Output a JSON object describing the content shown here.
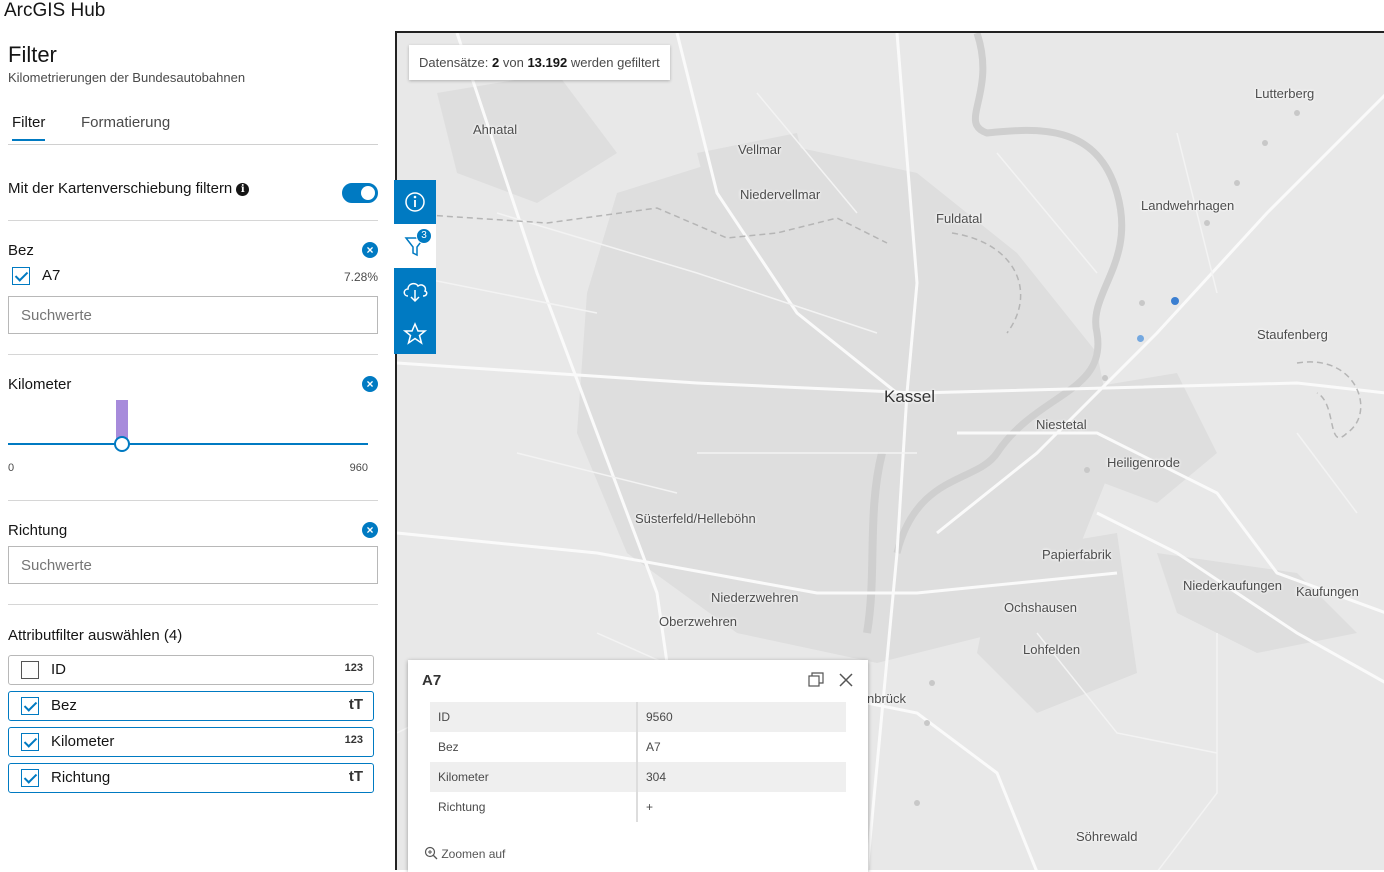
{
  "app": {
    "title": "ArcGIS Hub"
  },
  "panel": {
    "title": "Filter",
    "subtitle": "Kilometrierungen der Bundesautobahnen",
    "tabs": [
      {
        "label": "Filter"
      },
      {
        "label": "Formatierung"
      }
    ],
    "map_filter_toggle": {
      "label": "Mit der Kartenverschiebung filtern",
      "on": true
    }
  },
  "filters": {
    "bez": {
      "label": "Bez",
      "value_label": "A7",
      "checked": true,
      "percent": "7.28%",
      "search_placeholder": "Suchwerte"
    },
    "kilometer": {
      "label": "Kilometer",
      "min": "0",
      "max": "960",
      "value": 304
    },
    "richtung": {
      "label": "Richtung",
      "search_placeholder": "Suchwerte"
    }
  },
  "attribute_filters": {
    "title": "Attributfilter auswählen (4)",
    "items": [
      {
        "label": "ID",
        "checked": false,
        "type": "123"
      },
      {
        "label": "Bez",
        "checked": true,
        "type": "tT"
      },
      {
        "label": "Kilometer",
        "checked": true,
        "type": "123"
      },
      {
        "label": "Richtung",
        "checked": true,
        "type": "tT"
      }
    ]
  },
  "map": {
    "status": {
      "prefix": "Datensätze:",
      "count": "2",
      "middle": "von",
      "total": "13.192",
      "suffix": "werden gefiltert"
    },
    "places": [
      "Lutterberg",
      "Ahnatal",
      "Vellmar",
      "Niedervellmar",
      "Fuldatal",
      "Landwehrhagen",
      "Staufenberg",
      "Kassel",
      "Niestetal",
      "Heiligenrode",
      "Süsterfeld/Helleböhn",
      "Papierfabrik",
      "Niederkaufungen",
      "Kaufungen",
      "Niederzwehren",
      "Ochshausen",
      "Oberzwehren",
      "Lohfelden",
      "nbrück",
      "Söhrewald"
    ],
    "toolbar": {
      "filter_badge": "3"
    }
  },
  "popup": {
    "title": "A7",
    "rows": [
      {
        "key": "ID",
        "value": "9560"
      },
      {
        "key": "Bez",
        "value": "A7"
      },
      {
        "key": "Kilometer",
        "value": "304"
      },
      {
        "key": "Richtung",
        "value": "+"
      }
    ],
    "zoom_label": "Zoomen auf"
  },
  "colors": {
    "accent": "#007ac2",
    "slider_bar": "#a78bdb"
  }
}
